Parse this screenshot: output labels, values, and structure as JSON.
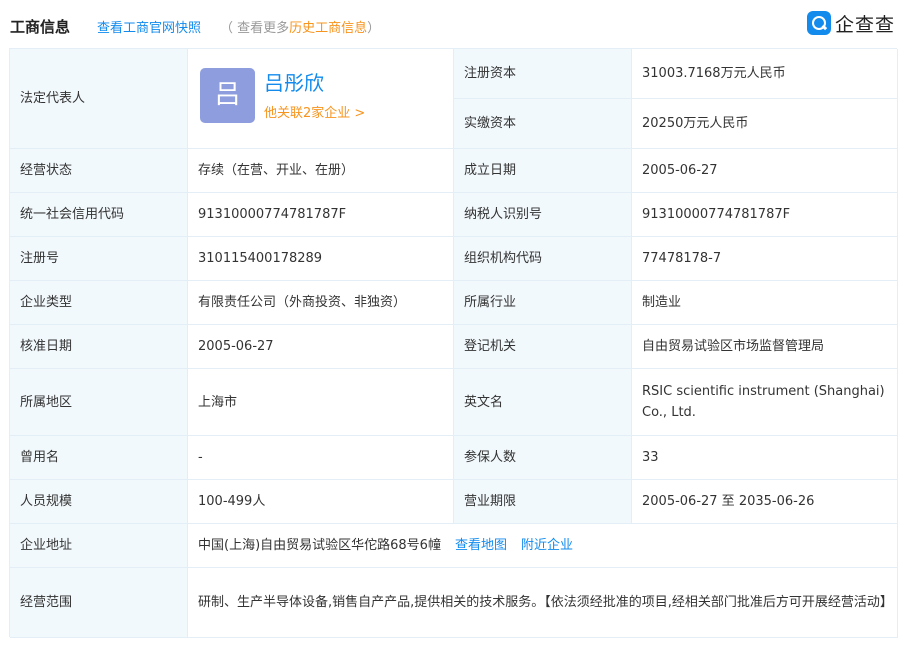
{
  "header": {
    "title": "工商信息",
    "snapshot_link": "查看工商官网快照",
    "more_prefix": "（ 查看更多",
    "more_link": "历史工商信息",
    "more_suffix": "）"
  },
  "logo": {
    "text": "企查查",
    "icon": "qichacha-logo-icon"
  },
  "legal": {
    "label": "法定代表人",
    "avatar_char": "吕",
    "name": "吕彤欣",
    "assoc": "他关联2家企业 >"
  },
  "fields": {
    "reg_capital": {
      "label": "注册资本",
      "value": "31003.7168万元人民币"
    },
    "paid_capital": {
      "label": "实缴资本",
      "value": "20250万元人民币"
    },
    "status": {
      "label": "经营状态",
      "value": "存续（在营、开业、在册）"
    },
    "founded": {
      "label": "成立日期",
      "value": "2005-06-27"
    },
    "credit_code": {
      "label": "统一社会信用代码",
      "value": "91310000774781787F"
    },
    "taxpayer_id": {
      "label": "纳税人识别号",
      "value": "91310000774781787F"
    },
    "reg_no": {
      "label": "注册号",
      "value": "310115400178289"
    },
    "org_code": {
      "label": "组织机构代码",
      "value": "77478178-7"
    },
    "company_type": {
      "label": "企业类型",
      "value": "有限责任公司（外商投资、非独资）"
    },
    "industry": {
      "label": "所属行业",
      "value": "制造业"
    },
    "approved": {
      "label": "核准日期",
      "value": "2005-06-27"
    },
    "authority": {
      "label": "登记机关",
      "value": "自由贸易试验区市场监督管理局"
    },
    "region": {
      "label": "所属地区",
      "value": "上海市"
    },
    "english_name": {
      "label": "英文名",
      "value": "RSIC scientific instrument (Shanghai) Co., Ltd."
    },
    "former_name": {
      "label": "曾用名",
      "value": "-"
    },
    "insured": {
      "label": "参保人数",
      "value": "33"
    },
    "staff_size": {
      "label": "人员规模",
      "value": "100-499人"
    },
    "term": {
      "label": "营业期限",
      "value": "2005-06-27 至 2035-06-26"
    },
    "address": {
      "label": "企业地址",
      "value": "中国(上海)自由贸易试验区华佗路68号6幢",
      "map_link": "查看地图",
      "nearby_link": "附近企业"
    },
    "scope": {
      "label": "经营范围",
      "value": "研制、生产半导体设备,销售自产产品,提供相关的技术服务。【依法须经批准的项目,经相关部门批准后方可开展经营活动】"
    }
  },
  "colors": {
    "link": "#128bed",
    "accent": "#f7941d",
    "label_bg": "#f2f9fc",
    "border": "#e4eef6",
    "avatar": "#8e9dde"
  }
}
